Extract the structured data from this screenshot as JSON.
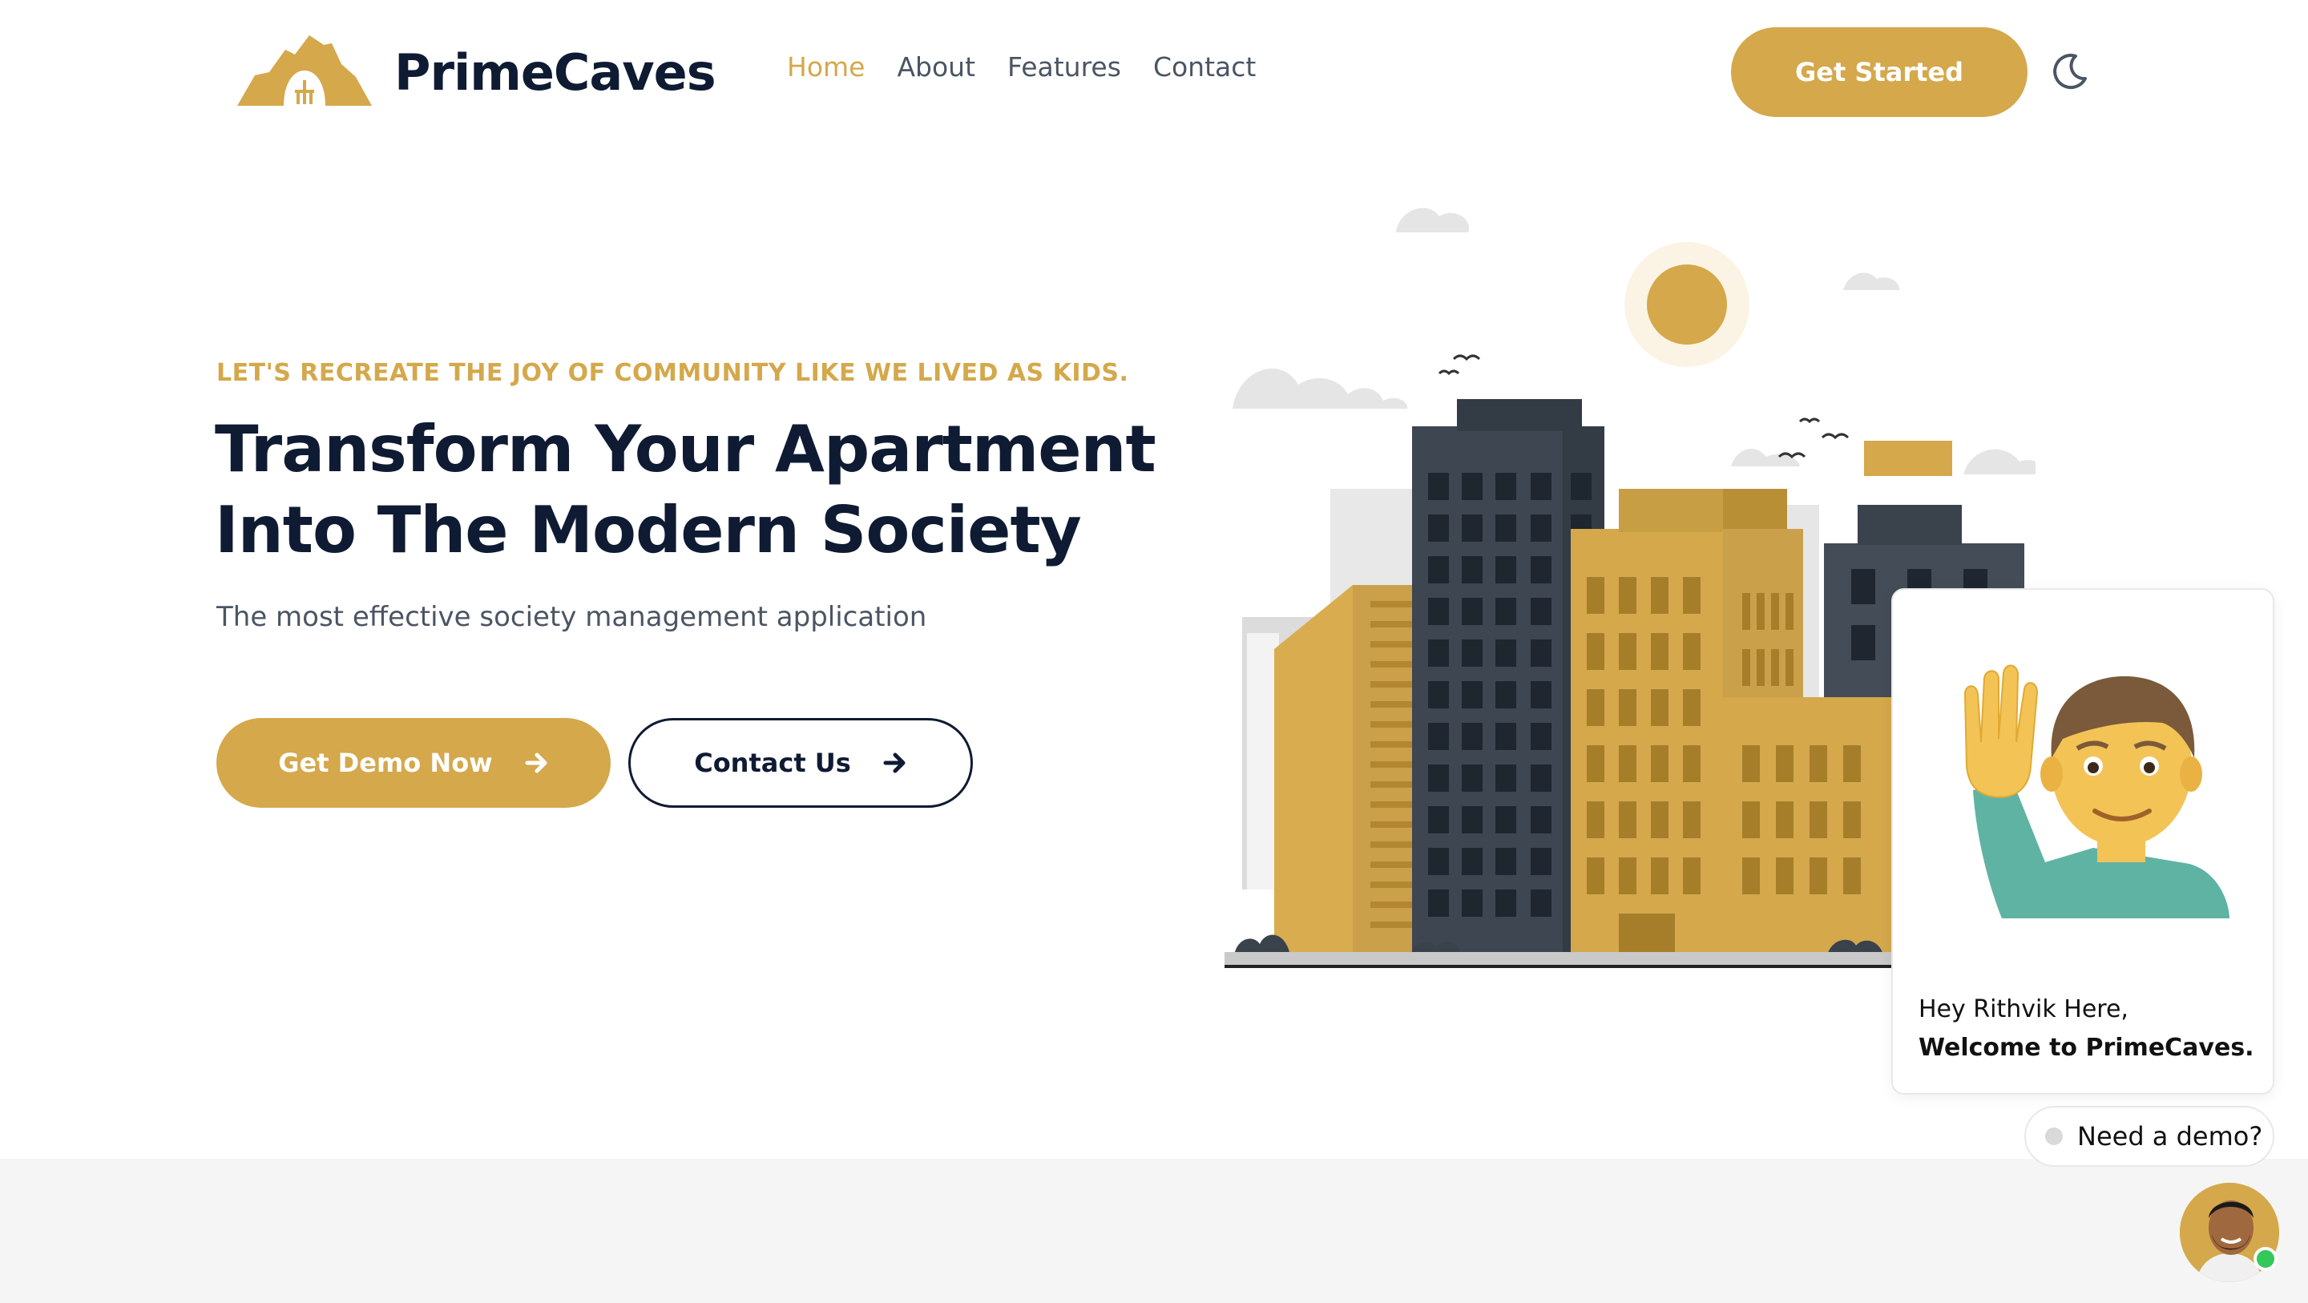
{
  "header": {
    "brand_name": "PrimeCaves",
    "logo_icon": "cave-logo-icon",
    "nav": [
      {
        "label": "Home",
        "active": true
      },
      {
        "label": "About",
        "active": false
      },
      {
        "label": "Features",
        "active": false
      },
      {
        "label": "Contact",
        "active": false
      }
    ],
    "cta_label": "Get Started",
    "theme_toggle_icon": "moon-icon"
  },
  "hero": {
    "eyebrow": "LET'S RECREATE THE JOY OF COMMUNITY LIKE WE LIVED AS KIDS.",
    "headline_line1": "Transform Your Apartment",
    "headline_line2": "Into The Modern Society",
    "subline": "The most effective society management application",
    "primary_button": "Get Demo Now",
    "secondary_button": "Contact Us",
    "button_icon": "arrow-right-icon",
    "illustration": "city-buildings-illustration"
  },
  "chat": {
    "emoji": "waving-man-emoji",
    "message_intro": "Hey Rithvik Here, ",
    "message_bold": "Welcome to PrimeCaves.",
    "prompt": "Need a demo?",
    "avatar": "agent-avatar",
    "status": "online"
  },
  "colors": {
    "accent": "#d4a84b",
    "navy": "#0f1b33",
    "text_muted": "#4b5563",
    "band": "#f5f5f5",
    "online": "#34c759"
  }
}
